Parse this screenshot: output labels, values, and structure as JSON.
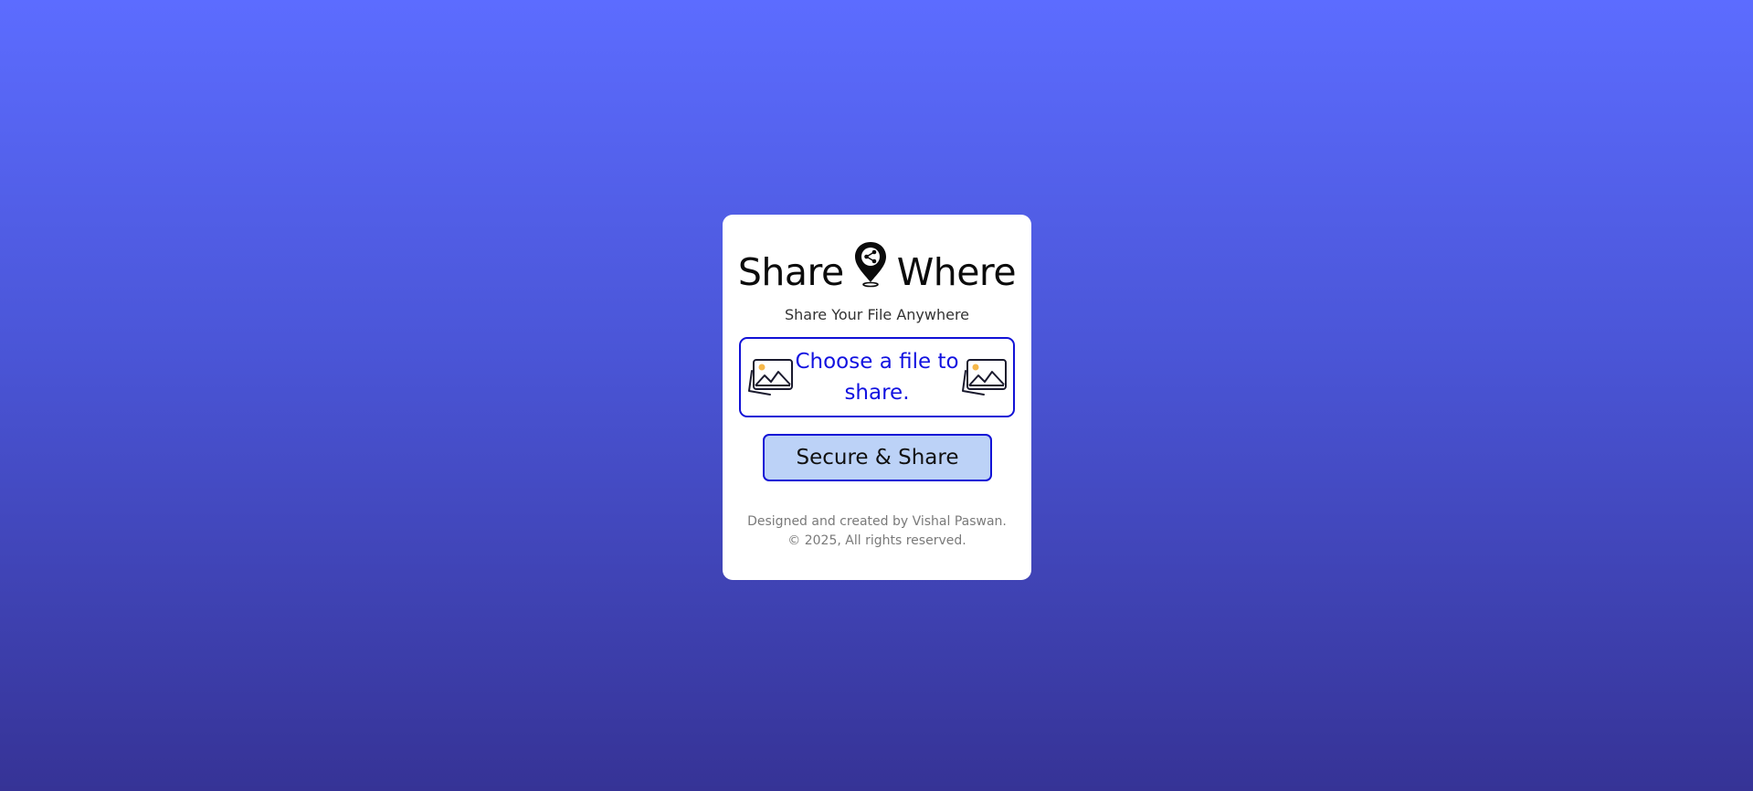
{
  "app": {
    "title_left": "Share",
    "title_right": "Where",
    "logo_icon": "location-pin-share-icon",
    "subtitle": "Share Your File Anywhere"
  },
  "file_picker": {
    "label": "Choose a file to share.",
    "left_icon": "image-gallery-icon",
    "right_icon": "image-gallery-icon",
    "border_color": "#1212d6",
    "text_color": "#1212e0"
  },
  "actions": {
    "share_label": "Secure & Share",
    "button_bg": "#bcd2f7"
  },
  "footer": {
    "credit": "Designed and created by Vishal Paswan.",
    "copyright": "© 2025, All rights reserved."
  },
  "colors": {
    "bg_top": "#5c6cff",
    "bg_bottom": "#363396",
    "card_bg": "#ffffff"
  }
}
